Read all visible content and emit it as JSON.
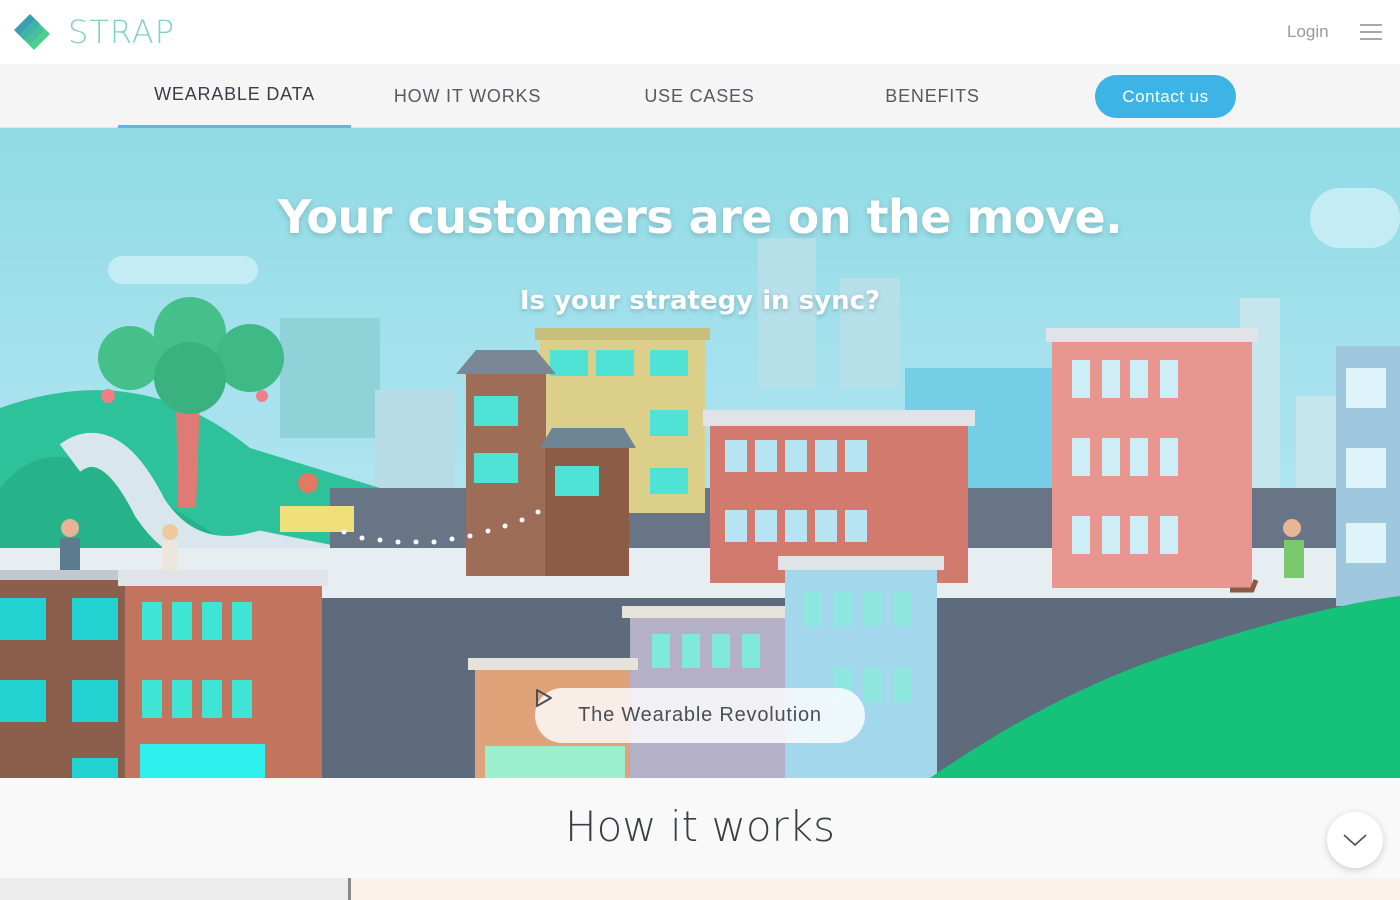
{
  "header": {
    "brand": "STRAP",
    "logo_icon": "strap-diamond-logo",
    "login_label": "Login",
    "menu_icon": "hamburger-icon"
  },
  "nav": {
    "items": [
      {
        "label": "WEARABLE DATA",
        "active": true
      },
      {
        "label": "HOW IT WORKS",
        "active": false
      },
      {
        "label": "USE CASES",
        "active": false
      },
      {
        "label": "BENEFITS",
        "active": false
      }
    ],
    "contact_label": "Contact us"
  },
  "hero": {
    "headline": "Your customers are on the move.",
    "subheadline": "Is your strategy in sync?",
    "video_label": "The Wearable Revolution",
    "video_icon": "play-icon"
  },
  "section": {
    "title": "How it works",
    "scroll_icon": "chevron-down-icon"
  },
  "colors": {
    "accent": "#3eb3e6",
    "brand": "#7fd1c4",
    "hill_green": "#1fbf7a",
    "sky": "#a7e2ee"
  }
}
